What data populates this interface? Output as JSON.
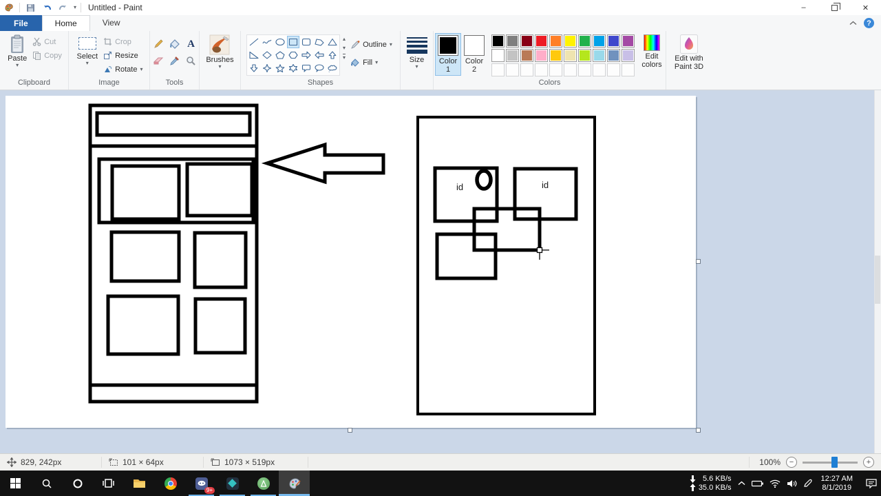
{
  "window": {
    "title": "Untitled - Paint"
  },
  "icons": {
    "dropdown": "▾",
    "scroll_up": "▴",
    "scroll_down": "▾",
    "minimize": "–",
    "close": "✕",
    "help": "?",
    "zoom_out": "−",
    "zoom_in": "+",
    "text_tool": "A"
  },
  "tabs": {
    "file": "File",
    "home": "Home",
    "view": "View"
  },
  "ribbon": {
    "clipboard": {
      "label": "Clipboard",
      "paste": "Paste",
      "cut": "Cut",
      "copy": "Copy"
    },
    "image": {
      "label": "Image",
      "select": "Select",
      "crop": "Crop",
      "resize": "Resize",
      "rotate": "Rotate"
    },
    "tools": {
      "label": "Tools"
    },
    "brushes": {
      "label": "Brushes"
    },
    "shapes": {
      "label": "Shapes",
      "outline": "Outline",
      "fill": "Fill",
      "items": [
        "line",
        "curve",
        "ellipse",
        "rectangle",
        "rounded-rectangle",
        "polygon",
        "triangle",
        "right-triangle",
        "diamond",
        "pentagon",
        "hexagon",
        "arrow-right",
        "arrow-left",
        "arrow-up",
        "arrow-down",
        "star-4",
        "star-5",
        "star-6",
        "callout-rounded",
        "callout-oval",
        "callout-cloud"
      ],
      "selected": "rectangle"
    },
    "size": {
      "label": "Size"
    },
    "colors": {
      "label": "Colors",
      "color1_label": "Color 1",
      "color2_label": "Color 2",
      "color1_value": "#000000",
      "color2_value": "#ffffff",
      "edit_colors": "Edit colors",
      "palette_row1": [
        "#000000",
        "#7f7f7f",
        "#880015",
        "#ed1c24",
        "#ff7f27",
        "#fff200",
        "#22b14c",
        "#00a2e8",
        "#3f48cc",
        "#a349a4"
      ],
      "palette_row2": [
        "#ffffff",
        "#c3c3c3",
        "#b97a57",
        "#ffaec9",
        "#ffc90e",
        "#efe4b0",
        "#b5e61d",
        "#99d9ea",
        "#7092be",
        "#c8bfe7"
      ],
      "palette_empty_count": 10
    },
    "paint3d": {
      "label": "Edit with Paint 3D"
    }
  },
  "canvas": {
    "id_label_left": "id",
    "id_label_right": "id"
  },
  "statusbar": {
    "cursor_pos": "829, 242px",
    "selection_size": "101 × 64px",
    "image_size": "1073 × 519px",
    "zoom_level": "100%"
  },
  "taskbar": {
    "discord_badge": "9+",
    "tray": {
      "down_speed": "5.6 KB/s",
      "up_speed": "35.0 KB/s",
      "time": "12:27 AM",
      "date": "8/1/2019"
    }
  },
  "ui_colors": {
    "file_tab": "#2864ac",
    "accent": "#1f7fd4",
    "run_underline": "#6cb2e8"
  }
}
